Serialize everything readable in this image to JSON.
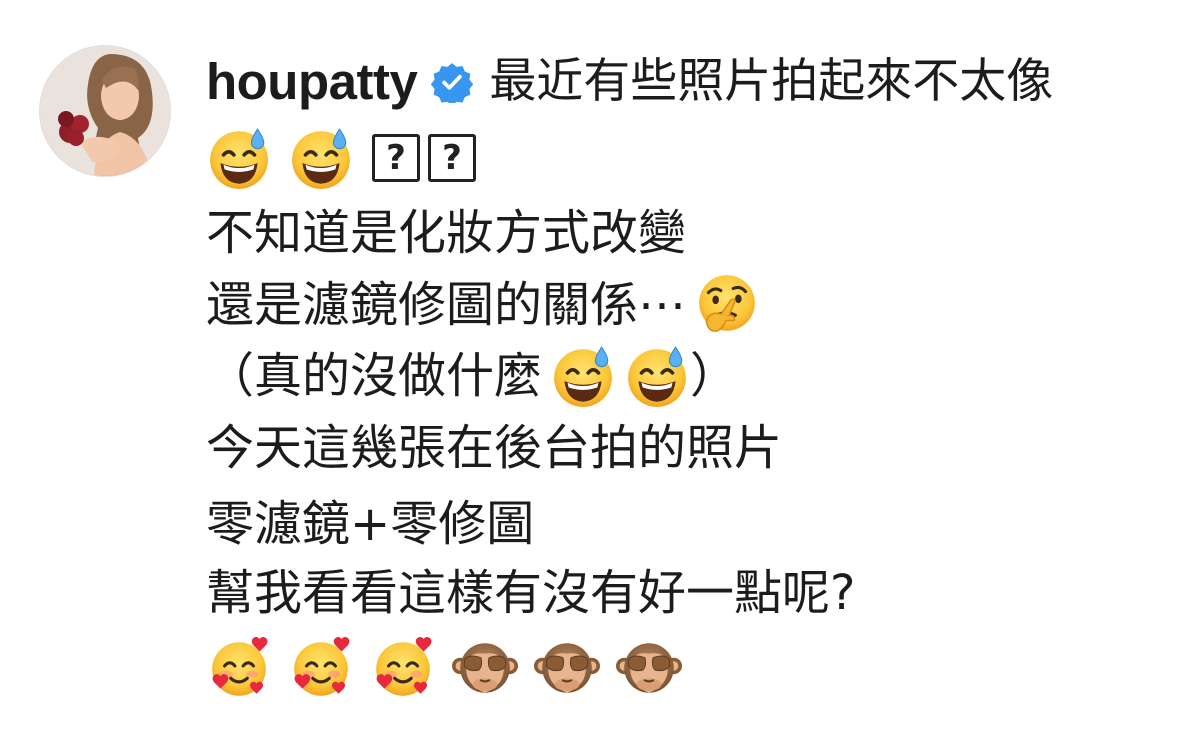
{
  "post": {
    "username": "houpatty",
    "verified_icon": "verified-badge-icon",
    "caption_first": "最近有些照片拍起來不太像",
    "line2_emojis": [
      "grinning-sweat-emoji",
      "grinning-sweat-emoji"
    ],
    "line2_unknown": [
      "?",
      "?"
    ],
    "line3": "不知道是化妝方式改變",
    "line4": "還是濾鏡修圖的關係⋯",
    "line4_emoji": "thinking-face-emoji",
    "line5_open": "（真的沒做什麼",
    "line5_emojis": [
      "grinning-sweat-emoji",
      "grinning-sweat-emoji"
    ],
    "line5_close": "）",
    "line6": "今天這幾張在後台拍的照片",
    "line7": "零濾鏡+零修圖",
    "line8": "幫我看看這樣有沒有好一點呢?",
    "line9_emojis": [
      "smiling-hearts-emoji",
      "smiling-hearts-emoji",
      "smiling-hearts-emoji",
      "see-no-evil-monkey-emoji",
      "see-no-evil-monkey-emoji",
      "see-no-evil-monkey-emoji"
    ]
  },
  "colors": {
    "verified_blue": "#3797f0",
    "text": "#1c1c1c",
    "background": "#ffffff"
  }
}
